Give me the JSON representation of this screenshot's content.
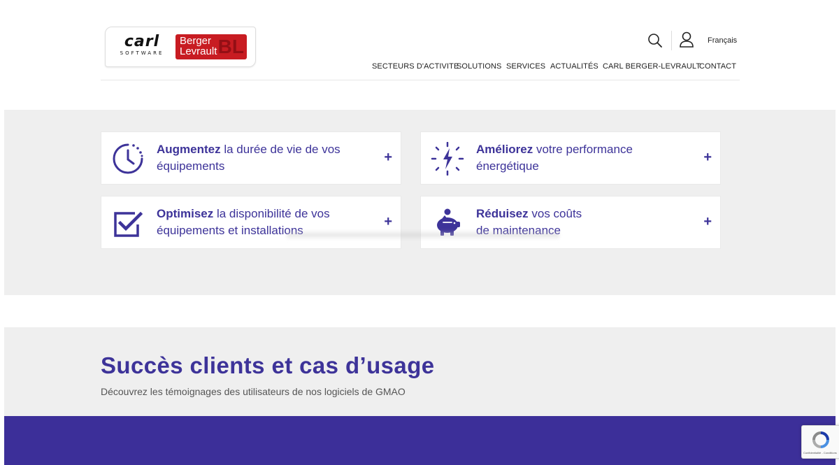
{
  "header": {
    "logo": {
      "carl_text": "carl",
      "carl_sub": "SOFTWARE",
      "bl_line1": "Berger",
      "bl_line2": "Levrault",
      "bl_mono": "BL"
    },
    "language": "Français",
    "icons": {
      "search": "search-icon",
      "user": "user-icon"
    },
    "nav": [
      "SECTEURS D'ACTIVITE",
      "SOLUTIONS",
      "SERVICES",
      "ACTUALITÉS",
      "CARL BERGER-LEVRAULT",
      "CONTACT"
    ]
  },
  "benefits": [
    {
      "strong": "Augmentez",
      "rest_line1": " la durée de vie de vos",
      "line2": "équipements",
      "icon": "clock-icon"
    },
    {
      "strong": "Améliorez",
      "rest_line1": " votre performance",
      "line2": "énergétique",
      "icon": "energy-icon"
    },
    {
      "strong": "Optimisez",
      "rest_line1": " la disponibilité de vos",
      "line2": "équipements et installations",
      "icon": "checkbox-icon"
    },
    {
      "strong": "Réduisez",
      "rest_line1": " vos coûts",
      "line2": "de maintenance",
      "icon": "piggy-bank-icon"
    }
  ],
  "plus_symbol": "+",
  "success": {
    "title": "Succès clients et cas d’usage",
    "subtitle": "Découvrez les témoignages des utilisateurs de nos logiciels de GMAO"
  },
  "recaptcha": {
    "text": "Confidentialité - Conditions"
  },
  "colors": {
    "brand": "#3d3399",
    "band": "#3c2f99",
    "section_bg": "#efefef",
    "bl_red": "#c81c22"
  }
}
